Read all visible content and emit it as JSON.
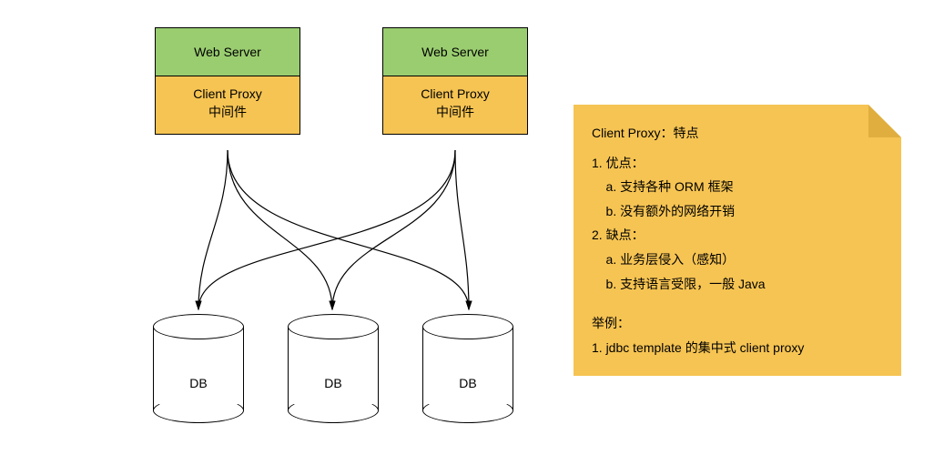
{
  "diagram": {
    "stacks": [
      {
        "web_label": "Web Server",
        "proxy_line1": "Client Proxy",
        "proxy_line2": "中间件"
      },
      {
        "web_label": "Web Server",
        "proxy_line1": "Client Proxy",
        "proxy_line2": "中间件"
      }
    ],
    "databases": [
      {
        "label": "DB"
      },
      {
        "label": "DB"
      },
      {
        "label": "DB"
      }
    ],
    "note": {
      "title": "Client Proxy：特点",
      "lines": [
        "1. 优点：",
        "    a. 支持各种 ORM 框架",
        "    b. 没有额外的网络开销",
        "2. 缺点：",
        "    a. 业务层侵入（感知）",
        "    b. 支持语言受限，一般 Java",
        "",
        "举例：",
        "1. jdbc template 的集中式 client proxy"
      ]
    }
  }
}
